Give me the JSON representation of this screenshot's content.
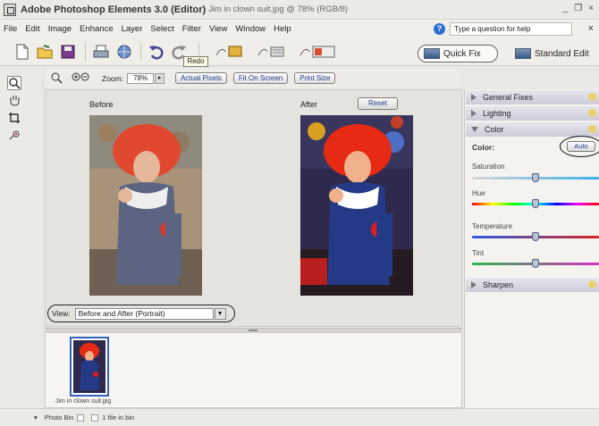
{
  "title_bar": {
    "app_title": "Adobe Photoshop Elements 3.0 (Editor)",
    "document_title": "Jim in clown suit.jpg @ 78% (RGB/8)",
    "controls": [
      "_",
      "❒",
      "×"
    ]
  },
  "menu": [
    "File",
    "Edit",
    "Image",
    "Enhance",
    "Layer",
    "Select",
    "Filter",
    "View",
    "Window",
    "Help"
  ],
  "help": {
    "placeholder": "Type a question for help",
    "close": "×"
  },
  "toolbar": {
    "redo_tooltip": "Redo"
  },
  "modes": {
    "quick_fix": "Quick Fix",
    "standard_edit": "Standard Edit"
  },
  "options": {
    "zoom_label": "Zoom:",
    "zoom_value": "78%",
    "actual_pixels": "Actual Pixels",
    "fit_on_screen": "Fit On Screen",
    "print_size": "Print Size"
  },
  "canvas": {
    "before_label": "Before",
    "after_label": "After",
    "reset": "Reset"
  },
  "view": {
    "label": "View:",
    "selected": "Before and After (Portrait)"
  },
  "photo_bin": {
    "thumbnail_caption": "Jim in clown suit.jpg"
  },
  "panel": {
    "sections": [
      {
        "label": "General Fixes",
        "expanded": false
      },
      {
        "label": "Lighting",
        "expanded": false
      },
      {
        "label": "Color",
        "expanded": true
      },
      {
        "label": "Sharpen",
        "expanded": false
      }
    ],
    "color_label": "Color:",
    "auto": "Auto",
    "sliders": [
      {
        "label": "Saturation",
        "value": 0.5
      },
      {
        "label": "Hue",
        "value": 0.5
      },
      {
        "label": "Temperature",
        "value": 0.5
      },
      {
        "label": "Tint",
        "value": 0.5
      }
    ]
  },
  "status": {
    "photo_bin": "Photo Bin",
    "file_count": "1 file in bin"
  },
  "colors": {
    "accent": "#2d6fd1",
    "panel_header": "#d7d5e0"
  }
}
